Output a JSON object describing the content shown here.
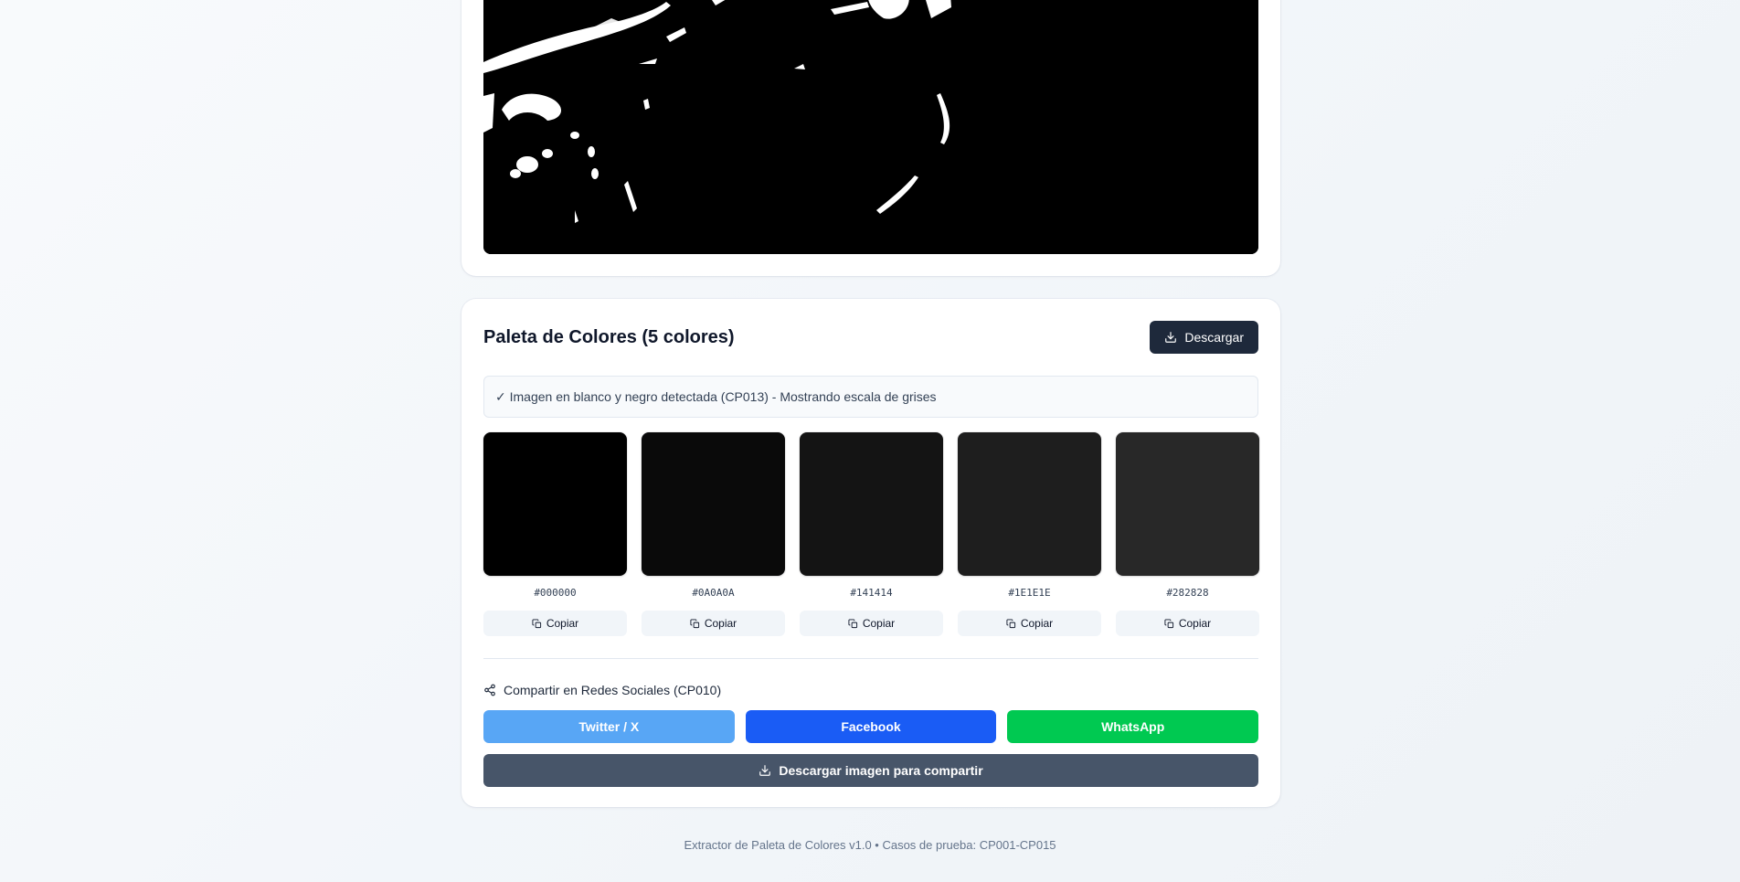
{
  "palette": {
    "title": "Paleta de Colores (5 colores)",
    "download_label": "Descargar",
    "notice": "✓ Imagen en blanco y negro detectada (CP013) - Mostrando escala de grises",
    "colors": [
      {
        "hex": "#000000",
        "copy_label": "Copiar"
      },
      {
        "hex": "#0A0A0A",
        "copy_label": "Copiar"
      },
      {
        "hex": "#141414",
        "copy_label": "Copiar"
      },
      {
        "hex": "#1E1E1E",
        "copy_label": "Copiar"
      },
      {
        "hex": "#282828",
        "copy_label": "Copiar"
      }
    ]
  },
  "share": {
    "title": "Compartir en Redes Sociales (CP010)",
    "twitter_label": "Twitter / X",
    "twitter_color": "#58a6f5",
    "facebook_label": "Facebook",
    "facebook_color": "#1a5cf5",
    "whatsapp_label": "WhatsApp",
    "whatsapp_color": "#00c951",
    "download_image_label": "Descargar imagen para compartir"
  },
  "footer": {
    "text": "Extractor de Paleta de Colores v1.0 • Casos de prueba: CP001-CP015"
  }
}
